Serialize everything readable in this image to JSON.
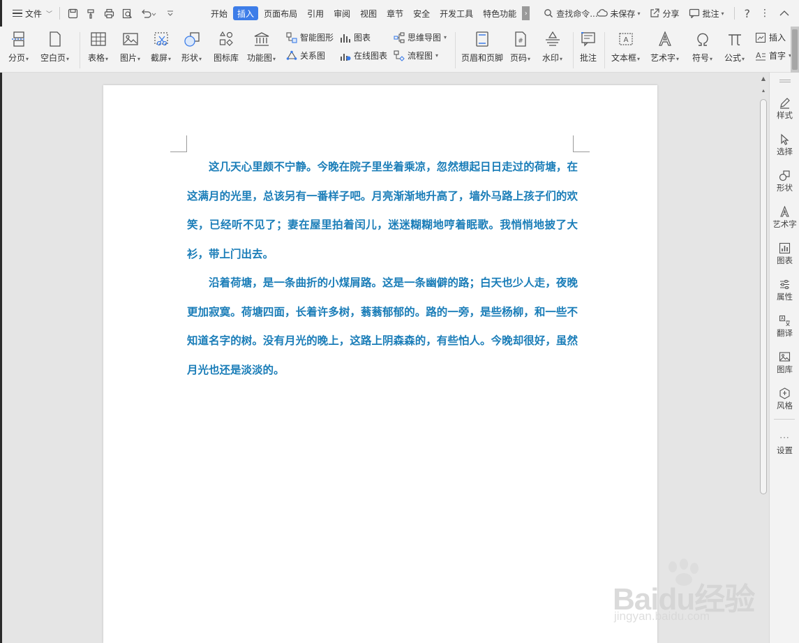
{
  "menubar": {
    "file_label": "文件",
    "tabs": [
      {
        "label": "开始",
        "active": false
      },
      {
        "label": "插入",
        "active": true
      },
      {
        "label": "页面布局",
        "active": false
      },
      {
        "label": "引用",
        "active": false
      },
      {
        "label": "审阅",
        "active": false
      },
      {
        "label": "视图",
        "active": false
      },
      {
        "label": "章节",
        "active": false
      },
      {
        "label": "安全",
        "active": false
      },
      {
        "label": "开发工具",
        "active": false
      },
      {
        "label": "特色功能",
        "active": false
      }
    ],
    "search_command": "查找命令...",
    "save_status": "未保存",
    "share": "分享",
    "comment": "批注",
    "help_icon": "question-icon",
    "accent_color": "#3d7de8"
  },
  "ribbon": {
    "page_break": "分页",
    "blank_page": "空白页",
    "table": "表格",
    "picture": "图片",
    "screenshot": "截屏",
    "shapes": "形状",
    "icon_library": "图标库",
    "function_chart": "功能图",
    "smart_shape": "智能图形",
    "chart": "图表",
    "mind_map": "思维导图",
    "relation_chart": "关系图",
    "online_chart": "在线图表",
    "flowchart": "流程图",
    "header_footer": "页眉和页脚",
    "page_number": "页码",
    "watermark": "水印",
    "annotation": "批注",
    "text_box": "文本框",
    "word_art": "艺术字",
    "symbol": "符号",
    "formula": "公式",
    "insert_more": "插入",
    "drop_cap": "首字"
  },
  "document": {
    "text_color": "#1a7db8",
    "paragraphs": [
      "这几天心里颇不宁静。今晚在院子里坐着乘凉，忽然想起日日走过的荷塘，在这满月的光里，总该另有一番样子吧。月亮渐渐地升高了，墙外马路上孩子们的欢笑，已经听不见了；妻在屋里拍着闰儿，迷迷糊糊地哼着眠歌。我悄悄地披了大衫，带上门出去。",
      "沿着荷塘，是一条曲折的小煤屑路。这是一条幽僻的路；白天也少人走，夜晚更加寂寞。荷塘四面，长着许多树，蓊蓊郁郁的。路的一旁，是些杨柳，和一些不知道名字的树。没有月光的晚上，这路上阴森森的，有些怕人。今晚却很好，虽然月光也还是淡淡的。"
    ]
  },
  "sidepanel": {
    "items": [
      {
        "label": "样式",
        "icon": "pen-icon"
      },
      {
        "label": "选择",
        "icon": "cursor-icon"
      },
      {
        "label": "形状",
        "icon": "shapes-icon"
      },
      {
        "label": "艺术字",
        "icon": "wordart-icon"
      },
      {
        "label": "图表",
        "icon": "chart-icon"
      },
      {
        "label": "属性",
        "icon": "sliders-icon"
      },
      {
        "label": "翻译",
        "icon": "translate-icon"
      },
      {
        "label": "图库",
        "icon": "gallery-icon"
      },
      {
        "label": "风格",
        "icon": "style-icon"
      },
      {
        "label": "设置",
        "icon": "settings-icon"
      }
    ]
  },
  "watermark": {
    "brand": "Baidu经验",
    "url": "jingyan.baidu.com"
  }
}
